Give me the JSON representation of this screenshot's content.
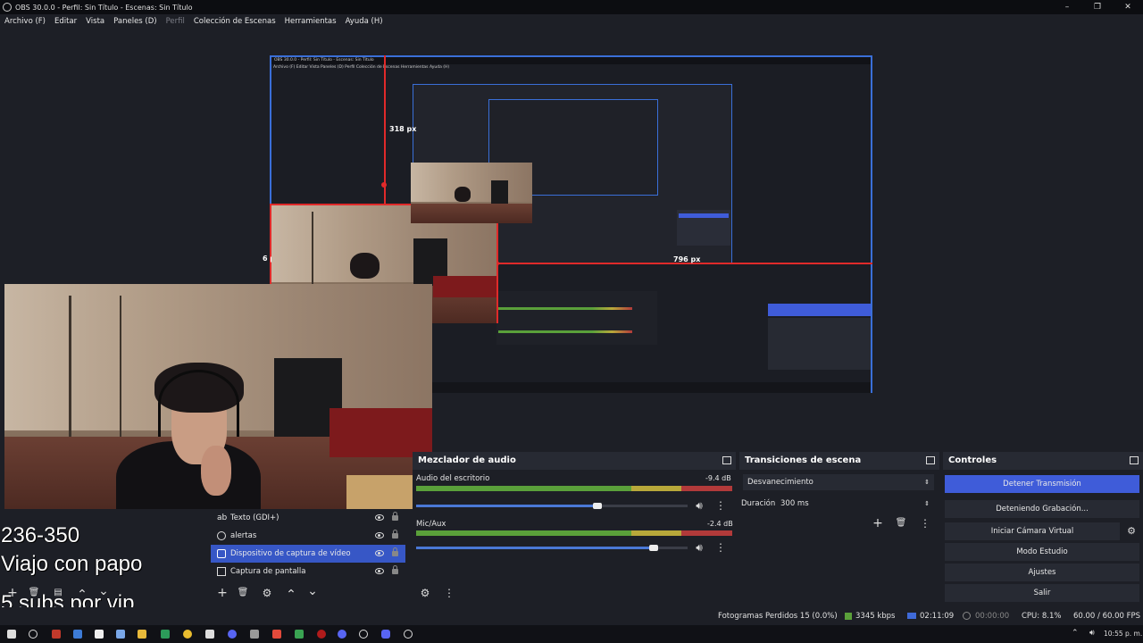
{
  "window": {
    "title": "OBS 30.0.0 - Perfil: Sin Título - Escenas: Sin Título",
    "minimize": "–",
    "maximize": "❐",
    "close": "✕"
  },
  "menu": {
    "items": [
      {
        "label": "Archivo (F)",
        "enabled": true
      },
      {
        "label": "Editar",
        "enabled": true
      },
      {
        "label": "Vista",
        "enabled": true
      },
      {
        "label": "Paneles (D)",
        "enabled": true
      },
      {
        "label": "Perfil",
        "enabled": false
      },
      {
        "label": "Colección de Escenas",
        "enabled": true
      },
      {
        "label": "Herramientas",
        "enabled": true
      },
      {
        "label": "Ayuda (H)",
        "enabled": true
      }
    ]
  },
  "preview": {
    "nested_title": "OBS 30.0.0 - Perfil: Sin Título - Escenas: Sin Título",
    "nested_menu": "Archivo (F)   Editar   Vista   Paneles (D)   Perfil   Colección de Escenas   Herramientas   Ayuda (H)",
    "measure_top": "318 px",
    "measure_left": "6 px",
    "measure_right": "796 px",
    "measure_inner": "796 px"
  },
  "sources": {
    "items": [
      {
        "label": "Texto (GDI+)",
        "icon": "text-icon",
        "selected": false
      },
      {
        "label": "alertas",
        "icon": "browser-icon",
        "selected": false
      },
      {
        "label": "Dispositivo de captura de vídeo",
        "icon": "camera-icon",
        "selected": true
      },
      {
        "label": "Captura de pantalla",
        "icon": "monitor-icon",
        "selected": false
      }
    ],
    "toolbar": {
      "add": "+",
      "remove": "🗑",
      "settings": "⚙",
      "up": "⌃",
      "down": "⌄"
    }
  },
  "mixer": {
    "title": "Mezclador de audio",
    "tracks": [
      {
        "name": "Audio del escritorio",
        "db": "-9.4 dB"
      },
      {
        "name": "Mic/Aux",
        "db": "-2.4 dB"
      }
    ],
    "scale": [
      "-60",
      "-55",
      "-50",
      "-45",
      "-40",
      "-35",
      "-30",
      "-25",
      "-20",
      "-15",
      "-10",
      "-5",
      "0"
    ]
  },
  "transitions": {
    "title": "Transiciones de escena",
    "selected": "Desvanecimiento",
    "duration_label": "Duración",
    "duration_value": "300 ms"
  },
  "controls": {
    "title": "Controles",
    "buttons": [
      "Detener Transmisión",
      "Deteniendo Grabación...",
      "Iniciar Cámara Virtual",
      "Modo Estudio",
      "Ajustes",
      "Salir"
    ]
  },
  "status": {
    "dropped": "Fotogramas Perdidos 15 (0.0%)",
    "bitrate": "3345 kbps",
    "stream_time": "02:11:09",
    "rec_time": "00:00:00",
    "cpu": "CPU: 8.1%",
    "fps": "60.00 / 60.00 FPS"
  },
  "overlay": {
    "line1": "236-350",
    "line2": "Viajo con papo",
    "line3": "5 subs por vip"
  },
  "taskbar": {
    "clock": "10:55 p. m."
  }
}
